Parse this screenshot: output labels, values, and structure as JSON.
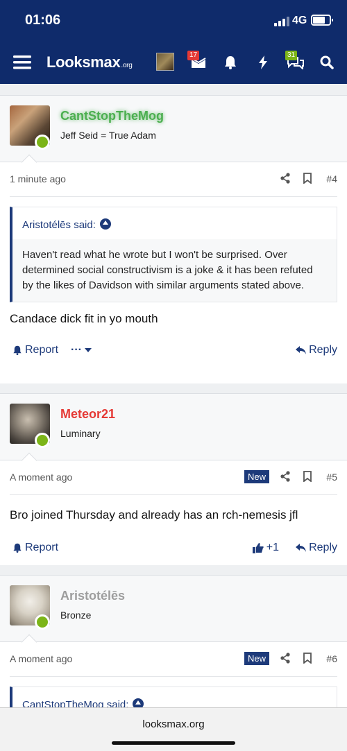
{
  "status_bar": {
    "time": "01:06",
    "network": "4G"
  },
  "nav": {
    "logo_main": "Looksmax",
    "logo_suffix": ".org",
    "inbox_badge": "17",
    "alerts_badge": "31",
    "inbox_badge_color": "#e53935",
    "alerts_badge_color": "#7cb518"
  },
  "posts": [
    {
      "username": "CantStopTheMog",
      "username_color": "#4caf50",
      "user_title": "Jeff Seid = True Adam",
      "time": "1 minute ago",
      "number": "#4",
      "quote_author": "Aristotélēs said:",
      "quote_text": "Haven't read what he wrote but I won't be surprised. Over determined social constructivism is a joke & it has been refuted by the likes of Davidson with similar arguments stated above.",
      "body": "Candace dick fit in yo mouth",
      "report_label": "Report",
      "reply_label": "Reply"
    },
    {
      "username": "Meteor21",
      "username_color": "#e53935",
      "user_title": "Luminary",
      "time": "A moment ago",
      "new_label": "New",
      "number": "#5",
      "body": "Bro joined Thursday and already has an rch-nemesis jfl",
      "report_label": "Report",
      "like_count": "+1",
      "reply_label": "Reply"
    },
    {
      "username": "Aristotélēs",
      "username_color": "#9e9e9e",
      "user_title": "Bronze",
      "time": "A moment ago",
      "new_label": "New",
      "number": "#6",
      "quote_author": "CantStopTheMog said:"
    }
  ],
  "browser": {
    "url": "looksmax.org"
  }
}
